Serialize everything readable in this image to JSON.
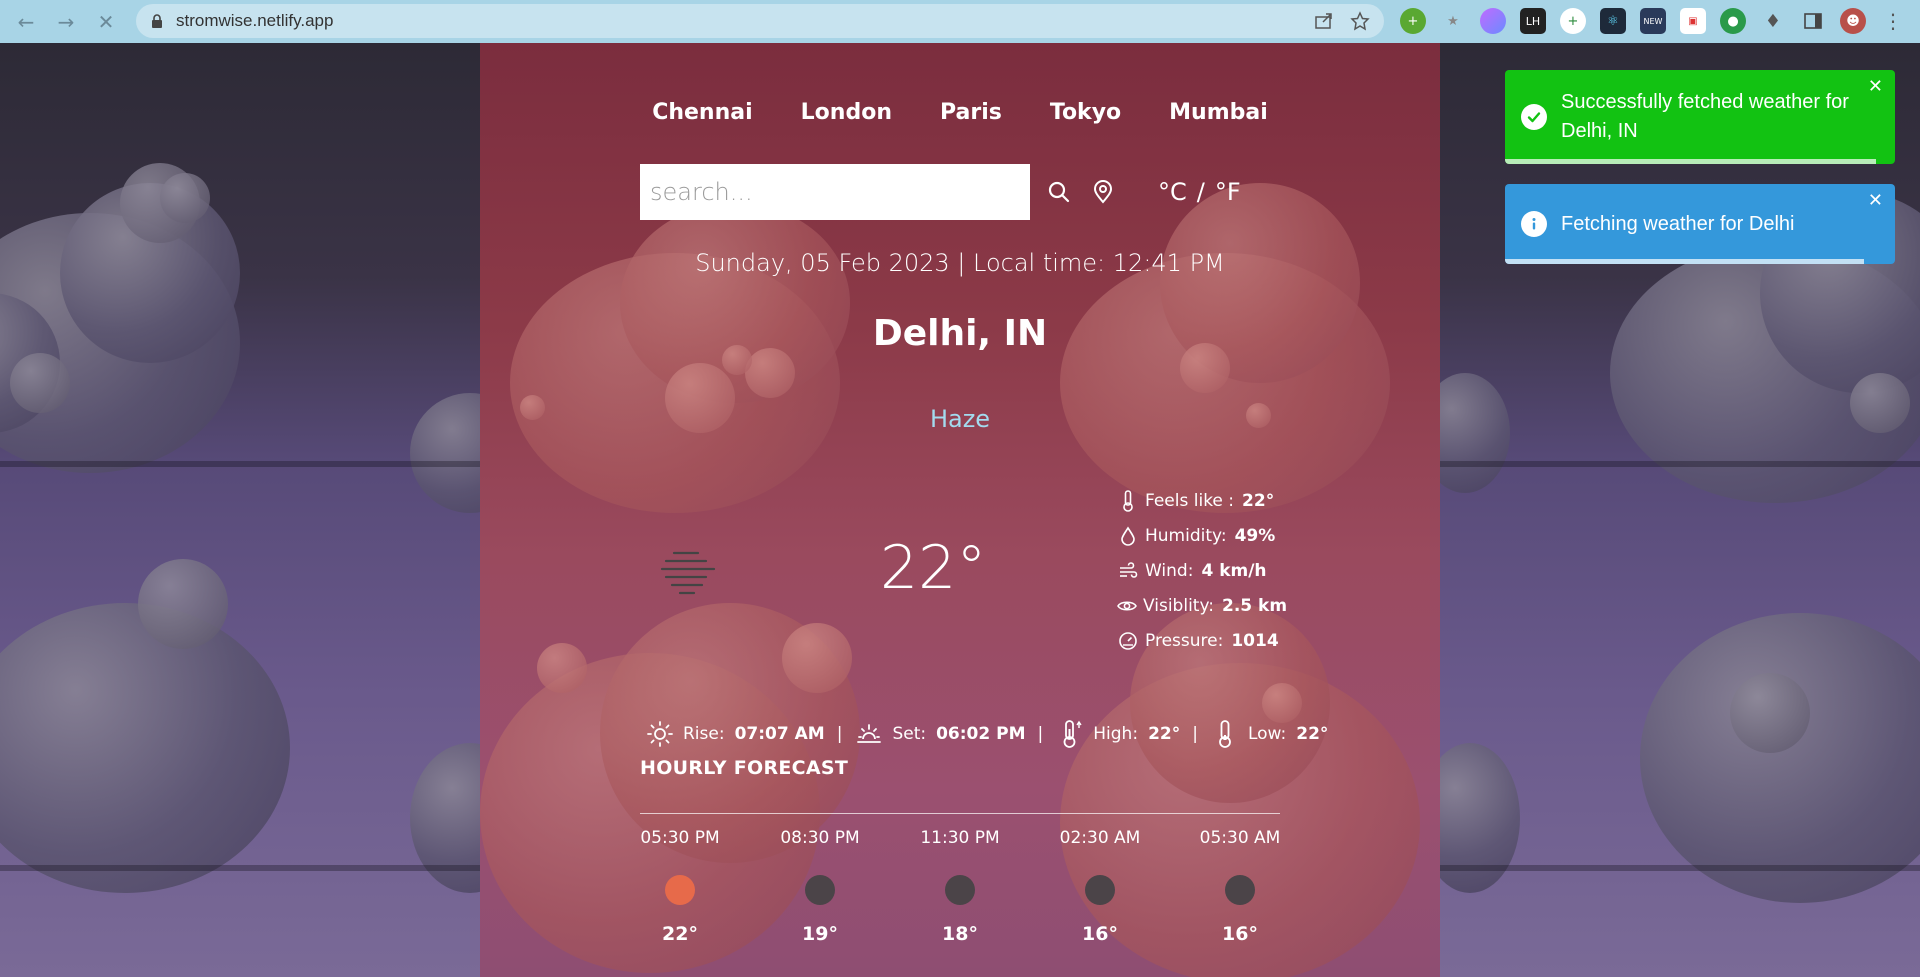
{
  "browser": {
    "url": "stromwise.netlify.app"
  },
  "nav": {
    "cities": [
      "Chennai",
      "London",
      "Paris",
      "Tokyo",
      "Mumbai"
    ]
  },
  "search": {
    "placeholder": "search..."
  },
  "units": {
    "celsius": "°C",
    "separator": "/",
    "fahrenheit": "°F"
  },
  "weather": {
    "date_time": "Sunday, 05 Feb 2023 | Local time: 12:41 PM",
    "location": "Delhi, IN",
    "condition": "Haze",
    "temperature": "22°",
    "details": [
      {
        "icon": "thermometer-icon",
        "label": "Feels like :",
        "value": "22°"
      },
      {
        "icon": "droplet-icon",
        "label": "Humidity:",
        "value": "49%"
      },
      {
        "icon": "wind-icon",
        "label": "Wind:",
        "value": "4 km/h"
      },
      {
        "icon": "eye-icon",
        "label": "Visiblity:",
        "value": "2.5 km"
      },
      {
        "icon": "pressure-gauge-icon",
        "label": "Pressure:",
        "value": "1014"
      }
    ],
    "sun": {
      "rise_label": "Rise:",
      "rise_value": "07:07 AM",
      "set_label": "Set:",
      "set_value": "06:02 PM",
      "high_label": "High:",
      "high_value": "22°",
      "low_label": "Low:",
      "low_value": "22°",
      "separator": "|"
    }
  },
  "forecast": {
    "title": "HOURLY FORECAST",
    "hours": [
      {
        "time": "05:30 PM",
        "temp": "22°",
        "icon": "sun-icon"
      },
      {
        "time": "08:30 PM",
        "temp": "19°",
        "icon": "moon-icon"
      },
      {
        "time": "11:30 PM",
        "temp": "18°",
        "icon": "moon-icon"
      },
      {
        "time": "02:30 AM",
        "temp": "16°",
        "icon": "moon-icon"
      },
      {
        "time": "05:30 AM",
        "temp": "16°",
        "icon": "moon-icon"
      }
    ]
  },
  "toasts": {
    "success_message": "Successfully fetched weather for Delhi, IN",
    "info_message": "Fetching weather for Delhi",
    "close_symbol": "✕",
    "success_progress": 0.95,
    "info_progress": 0.92
  },
  "colors": {
    "toast_success": "#12c212",
    "toast_info": "#3498db",
    "condition_text": "#a3dbef",
    "sun_dot": "#e76a4a"
  }
}
